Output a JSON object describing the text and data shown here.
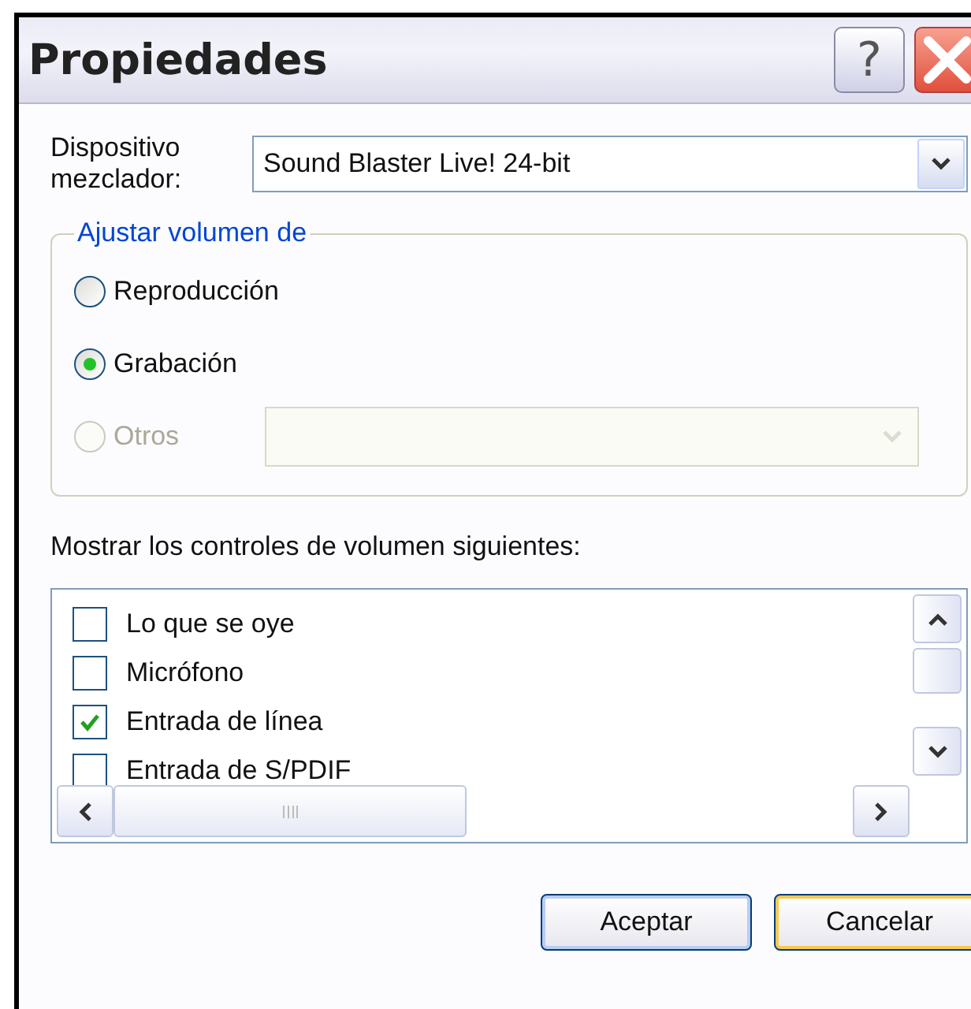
{
  "window": {
    "title": "Propiedades",
    "help_button": "?"
  },
  "mixer": {
    "label": "Dispositivo mezclador:",
    "value": "Sound Blaster Live! 24-bit"
  },
  "volume_group": {
    "legend": "Ajustar volumen de",
    "options": [
      {
        "label": "Reproducción",
        "selected": false,
        "disabled": false
      },
      {
        "label": "Grabación",
        "selected": true,
        "disabled": false
      },
      {
        "label": "Otros",
        "selected": false,
        "disabled": true
      }
    ]
  },
  "controls": {
    "label": "Mostrar los controles de volumen siguientes:",
    "items": [
      {
        "label": "Lo que se oye",
        "checked": false
      },
      {
        "label": "Micrófono",
        "checked": false
      },
      {
        "label": "Entrada de línea",
        "checked": true
      },
      {
        "label": "Entrada de S/PDIF",
        "checked": false
      }
    ]
  },
  "buttons": [
    {
      "label": "Aceptar",
      "focused": false
    },
    {
      "label": "Cancelar",
      "focused": true
    }
  ]
}
